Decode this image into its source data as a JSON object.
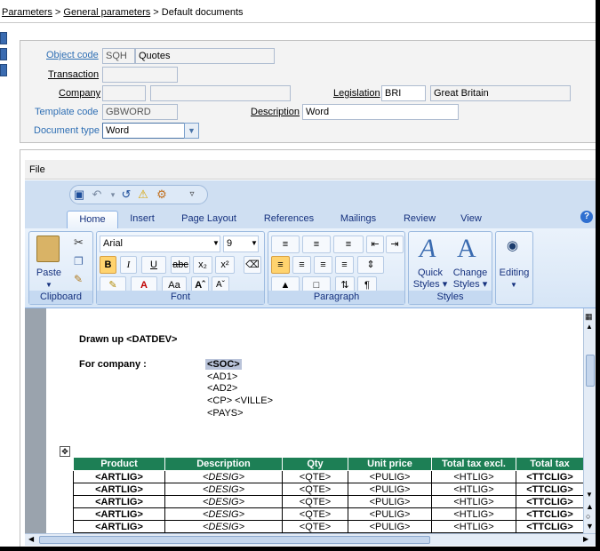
{
  "breadcrumb": {
    "item1": "Parameters",
    "sep1": " > ",
    "item2": "General parameters",
    "sep2": " > ",
    "current": "Default documents"
  },
  "form": {
    "object_code": {
      "label": "Object code",
      "code": "SQH",
      "name": "Quotes"
    },
    "transaction": {
      "label": "Transaction",
      "value": ""
    },
    "company": {
      "label": "Company",
      "code": "",
      "name": ""
    },
    "legislation": {
      "label": "Legislation",
      "code": "BRI",
      "name": "Great Britain"
    },
    "template_code": {
      "label": "Template code",
      "value": "GBWORD"
    },
    "description": {
      "label": "Description",
      "value": "Word"
    },
    "document_type": {
      "label": "Document type",
      "value": "Word"
    }
  },
  "word": {
    "file_menu": "File",
    "tabs": [
      "Home",
      "Insert",
      "Page Layout",
      "References",
      "Mailings",
      "Review",
      "View"
    ],
    "active_tab": "Home",
    "groups": {
      "clipboard": {
        "label": "Clipboard",
        "paste": "Paste"
      },
      "font": {
        "label": "Font",
        "font_name": "Arial",
        "font_size": "9"
      },
      "paragraph": {
        "label": "Paragraph"
      },
      "styles": {
        "label": "Styles",
        "quick_styles_1": "Quick",
        "quick_styles_2": "Styles",
        "change_styles_1": "Change",
        "change_styles_2": "Styles"
      },
      "editing": {
        "label": "Editing"
      }
    },
    "icons": {
      "save": "save-icon",
      "undo": "undo-icon",
      "redo": "redo-icon",
      "help": "help-icon"
    },
    "colors": {
      "ribbon": "#cfdff2",
      "table_header": "#1d7f55",
      "accent": "#15317e"
    }
  },
  "document": {
    "drawn_up": "Drawn up <DATDEV>",
    "for_company_label": "For company :",
    "address": [
      "<SOC>",
      "<AD1>",
      "<AD2>",
      "<CP>  <VILLE>",
      "<PAYS>"
    ],
    "table": {
      "headers": [
        "Product",
        "Description",
        "Qty",
        "Unit price",
        "Total tax excl.",
        "Total tax"
      ],
      "rows": [
        [
          "<ARTLIG>",
          "<DESIG>",
          "<QTE>",
          "<PULIG>",
          "<HTLIG>",
          "<TTCLIG>"
        ],
        [
          "<ARTLIG>",
          "<DESIG>",
          "<QTE>",
          "<PULIG>",
          "<HTLIG>",
          "<TTCLIG>"
        ],
        [
          "<ARTLIG>",
          "<DESIG>",
          "<QTE>",
          "<PULIG>",
          "<HTLIG>",
          "<TTCLIG>"
        ],
        [
          "<ARTLIG>",
          "<DESIG>",
          "<QTE>",
          "<PULIG>",
          "<HTLIG>",
          "<TTCLIG>"
        ],
        [
          "<ARTLIG>",
          "<DESIG>",
          "<QTE>",
          "<PULIG>",
          "<HTLIG>",
          "<TTCLIG>"
        ]
      ]
    }
  }
}
